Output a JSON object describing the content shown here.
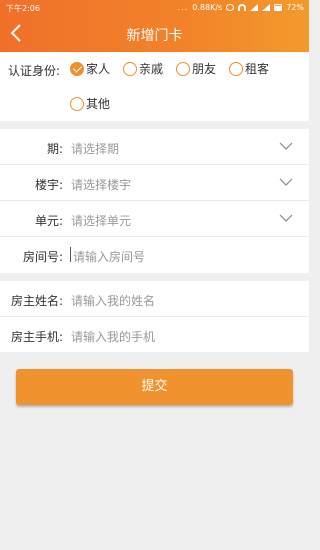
{
  "status_bar": {
    "time": "下午2:06",
    "dots": "...",
    "speed": "0.88K/s",
    "battery": "72%"
  },
  "header": {
    "title": "新增门卡",
    "back_icon": "chevron-left-icon"
  },
  "identity": {
    "label": "认证身份:",
    "options": [
      "家人",
      "亲戚",
      "朋友",
      "租客",
      "其他"
    ],
    "selected": "家人"
  },
  "address": {
    "rows": [
      {
        "label": "期:",
        "placeholder": "请选择期",
        "type": "select"
      },
      {
        "label": "楼宇:",
        "placeholder": "请选择楼宇",
        "type": "select"
      },
      {
        "label": "单元:",
        "placeholder": "请选择单元",
        "type": "select"
      },
      {
        "label": "房间号:",
        "placeholder": "请输入房间号",
        "type": "input"
      }
    ]
  },
  "owner": {
    "rows": [
      {
        "label": "房主姓名:",
        "placeholder": "请输入我的姓名"
      },
      {
        "label": "房主手机:",
        "placeholder": "请输入我的手机"
      }
    ]
  },
  "submit_label": "提交",
  "colors": {
    "accent": "#f0922d",
    "header_start": "#f0702a",
    "header_end": "#f39a2c",
    "background": "#efefef"
  }
}
